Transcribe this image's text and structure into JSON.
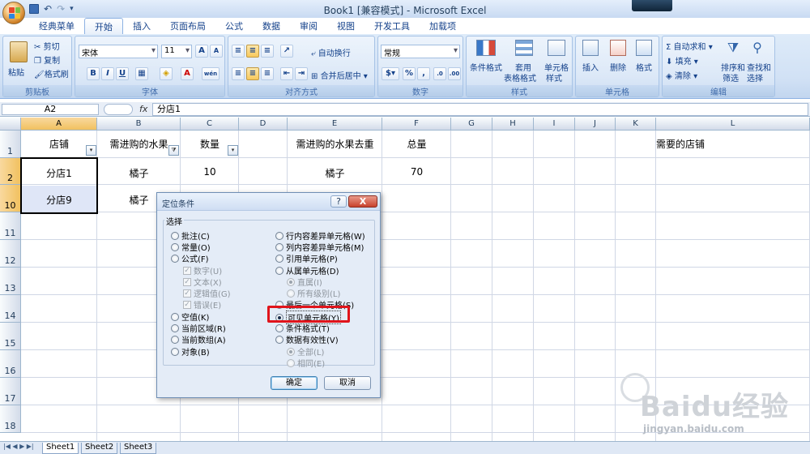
{
  "window": {
    "title": "Book1  [兼容模式] - Microsoft Excel"
  },
  "tabs": [
    "经典菜单",
    "开始",
    "插入",
    "页面布局",
    "公式",
    "数据",
    "审阅",
    "视图",
    "开发工具",
    "加载项"
  ],
  "ribbon": {
    "clipboard": {
      "paste": "粘贴",
      "cut": "剪切",
      "copy": "复制",
      "format_painter": "格式刷",
      "name": "剪贴板"
    },
    "font": {
      "font_name": "宋体",
      "font_size": "11",
      "bold": "B",
      "italic": "I",
      "underline": "U",
      "name": "字体",
      "wen": "wén"
    },
    "alignment": {
      "wrap": "自动换行",
      "merge": "合并后居中",
      "name": "对齐方式"
    },
    "number": {
      "format": "常规",
      "percent": "%",
      "comma": ",",
      "name": "数字"
    },
    "styles": {
      "conditional": "条件格式",
      "table_l1": "套用",
      "table_l2": "表格格式",
      "cell_style_l1": "单元格",
      "cell_style_l2": "样式",
      "name": "样式"
    },
    "cells": {
      "insert": "插入",
      "delete": "删除",
      "format": "格式",
      "name": "单元格"
    },
    "editing": {
      "autosum": "自动求和",
      "fill": "填充",
      "clear": "清除",
      "sort_l1": "排序和",
      "sort_l2": "筛选",
      "find_l1": "查找和",
      "find_l2": "选择",
      "name": "编辑"
    }
  },
  "formula_bar": {
    "name_box": "A2",
    "fx": "fx",
    "content": "分店1"
  },
  "columns": [
    "A",
    "B",
    "C",
    "D",
    "E",
    "F",
    "G",
    "H",
    "I",
    "J",
    "K",
    "L"
  ],
  "rows": [
    "1",
    "2",
    "10",
    "11",
    "12",
    "13",
    "14",
    "15",
    "16",
    "17",
    "18"
  ],
  "cells": {
    "A1": "店铺",
    "B1": "需进购的水果",
    "C1": "数量",
    "E1": "需进购的水果去重",
    "F1": "总量",
    "L1": "需要的店铺",
    "A2": "分店1",
    "B2": "橘子",
    "C2": "10",
    "E2": "橘子",
    "F2": "70",
    "A10": "分店9",
    "B10": "橘子"
  },
  "dialog": {
    "title": "定位条件",
    "help": "?",
    "close": "X",
    "group_label": "选择",
    "left_options": [
      {
        "label": "批注(C)",
        "kind": "radio",
        "checked": false,
        "disabled": false
      },
      {
        "label": "常量(O)",
        "kind": "radio",
        "checked": false,
        "disabled": false
      },
      {
        "label": "公式(F)",
        "kind": "radio",
        "checked": false,
        "disabled": false
      },
      {
        "label": "数字(U)",
        "kind": "check",
        "checked": true,
        "disabled": true
      },
      {
        "label": "文本(X)",
        "kind": "check",
        "checked": true,
        "disabled": true
      },
      {
        "label": "逻辑值(G)",
        "kind": "check",
        "checked": true,
        "disabled": true
      },
      {
        "label": "错误(E)",
        "kind": "check",
        "checked": true,
        "disabled": true
      },
      {
        "label": "空值(K)",
        "kind": "radio",
        "checked": false,
        "disabled": false
      },
      {
        "label": "当前区域(R)",
        "kind": "radio",
        "checked": false,
        "disabled": false
      },
      {
        "label": "当前数组(A)",
        "kind": "radio",
        "checked": false,
        "disabled": false
      },
      {
        "label": "对象(B)",
        "kind": "radio",
        "checked": false,
        "disabled": false
      }
    ],
    "right_options": [
      {
        "label": "行内容差异单元格(W)",
        "kind": "radio",
        "checked": false,
        "disabled": false
      },
      {
        "label": "列内容差异单元格(M)",
        "kind": "radio",
        "checked": false,
        "disabled": false
      },
      {
        "label": "引用单元格(P)",
        "kind": "radio",
        "checked": false,
        "disabled": false
      },
      {
        "label": "从属单元格(D)",
        "kind": "radio",
        "checked": false,
        "disabled": false
      },
      {
        "label": "直属(I)",
        "kind": "radio",
        "checked": true,
        "disabled": true
      },
      {
        "label": "所有级别(L)",
        "kind": "radio",
        "checked": false,
        "disabled": true
      },
      {
        "label": "最后一个单元格(S)",
        "kind": "radio",
        "checked": false,
        "disabled": false
      },
      {
        "label": "可见单元格(Y)",
        "kind": "radio",
        "checked": true,
        "disabled": false
      },
      {
        "label": "条件格式(T)",
        "kind": "radio",
        "checked": false,
        "disabled": false
      },
      {
        "label": "数据有效性(V)",
        "kind": "radio",
        "checked": false,
        "disabled": false
      },
      {
        "label": "全部(L)",
        "kind": "radio",
        "checked": true,
        "disabled": true
      },
      {
        "label": "相同(E)",
        "kind": "radio",
        "checked": false,
        "disabled": true
      }
    ],
    "ok": "确定",
    "cancel": "取消"
  },
  "sheets": [
    "Sheet1",
    "Sheet2",
    "Sheet3"
  ],
  "watermark": {
    "main": "Baidu经验",
    "url": "jingyan.baidu.com"
  },
  "colors": {
    "highlight": "#e0141b",
    "selection": "#f1c15f",
    "ribbon": "#d1e1f5"
  }
}
